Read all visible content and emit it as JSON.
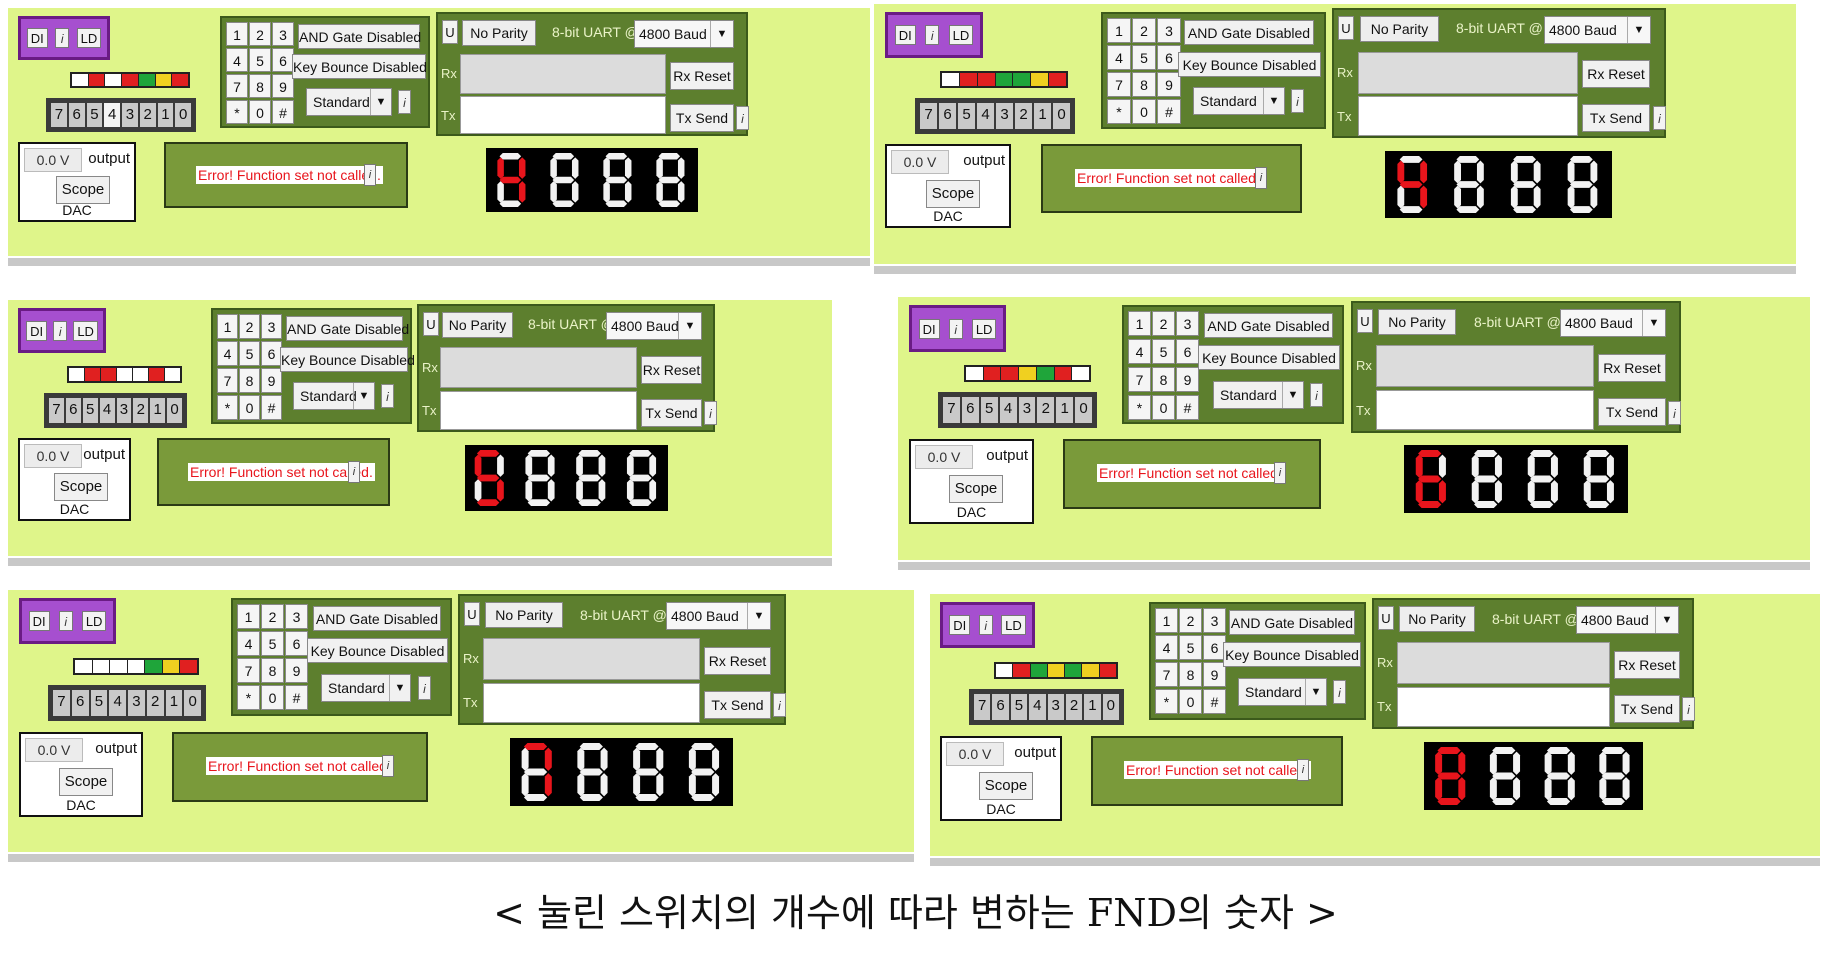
{
  "labels": {
    "di": "DI",
    "info": "i",
    "ld": "LD",
    "bits": [
      "7",
      "6",
      "5",
      "4",
      "3",
      "2",
      "1",
      "0"
    ],
    "dac_value": "0.0 V",
    "dac_output": "output",
    "scope": "Scope",
    "dac": "DAC",
    "keys": [
      "1",
      "2",
      "3",
      "4",
      "5",
      "6",
      "7",
      "8",
      "9",
      "*",
      "0",
      "#"
    ],
    "and_gate": "AND Gate Disabled",
    "key_bounce": "Key Bounce Disabled",
    "mode": "Standard",
    "uart_u": "U",
    "parity": "No Parity",
    "uart_desc": "8-bit UART @",
    "baud": "4800 Baud",
    "rx": "Rx",
    "tx": "Tx",
    "rx_reset": "Rx Reset",
    "tx_send": "Tx Send",
    "lcd_message": "Error! Function set not called."
  },
  "colors": {
    "panel_bg": "#dff58a",
    "module_green": "#5d7f2e",
    "fnd_on": "#e8151c",
    "fnd_off": "#f2f2f2",
    "led_red": "#e02020",
    "led_green": "#1fa53a",
    "led_yellow": "#f0d020",
    "led_white": "#ffffff",
    "di_purple": "#a64fcf"
  },
  "panels": [
    {
      "leds": [
        "white",
        "red",
        "white",
        "red",
        "green",
        "yellow",
        "red"
      ],
      "bit_on": [
        3
      ],
      "digit": 4
    },
    {
      "leds": [
        "white",
        "red",
        "red",
        "green",
        "green",
        "yellow",
        "red"
      ],
      "bit_on": [],
      "digit": 4
    },
    {
      "leds": [
        "white",
        "red",
        "red",
        "white",
        "white",
        "red",
        "white"
      ],
      "bit_on": [],
      "digit": 5
    },
    {
      "leds": [
        "white",
        "red",
        "red",
        "yellow",
        "green",
        "red",
        "white"
      ],
      "bit_on": [],
      "digit": 6
    },
    {
      "leds": [
        "white",
        "white",
        "white",
        "white",
        "green",
        "yellow",
        "red"
      ],
      "bit_on": [],
      "digit": 7
    },
    {
      "leds": [
        "white",
        "red",
        "green",
        "yellow",
        "green",
        "yellow",
        "red"
      ],
      "bit_on": [],
      "digit": 8
    }
  ],
  "caption": "< 눌린 스위치의 개수에 따라 변하는 FND의 숫자 >"
}
